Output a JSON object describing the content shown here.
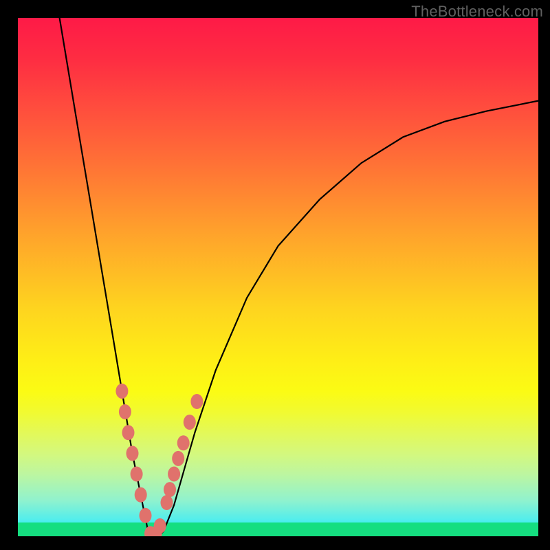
{
  "watermark": "TheBottleneck.com",
  "chart_data": {
    "type": "line",
    "title": "",
    "xlabel": "",
    "ylabel": "",
    "xlim": [
      0,
      100
    ],
    "ylim": [
      0,
      100
    ],
    "series": [
      {
        "name": "bottleneck-curve",
        "x": [
          8,
          10,
          12,
          14,
          16,
          18,
          20,
          22,
          24,
          25,
          26,
          27,
          28,
          30,
          32,
          34,
          38,
          44,
          50,
          58,
          66,
          74,
          82,
          90,
          100
        ],
        "y": [
          100,
          88,
          76,
          64,
          52,
          40,
          28,
          16,
          6,
          1,
          0,
          0,
          1,
          6,
          13,
          20,
          32,
          46,
          56,
          65,
          72,
          77,
          80,
          82,
          84
        ]
      }
    ],
    "marker_points": {
      "name": "highlight-markers",
      "x": [
        20.0,
        20.6,
        21.2,
        22.0,
        22.8,
        23.6,
        24.5,
        25.5,
        26.5,
        27.3,
        28.6,
        29.2,
        30.0,
        30.8,
        31.8,
        33.0,
        34.4
      ],
      "y": [
        28.0,
        24.0,
        20.0,
        16.0,
        12.0,
        8.0,
        4.0,
        0.5,
        0.5,
        2.0,
        6.5,
        9.0,
        12.0,
        15.0,
        18.0,
        22.0,
        26.0
      ]
    },
    "gradient_stops": [
      {
        "pos": 0,
        "color": "#fe1a47"
      },
      {
        "pos": 18,
        "color": "#ff4f3d"
      },
      {
        "pos": 42,
        "color": "#ffa42b"
      },
      {
        "pos": 66,
        "color": "#feee16"
      },
      {
        "pos": 88,
        "color": "#bdf6a0"
      },
      {
        "pos": 100,
        "color": "#16e9fe"
      }
    ],
    "green_band_color": "#15de80",
    "marker_color": "#e0726c"
  }
}
